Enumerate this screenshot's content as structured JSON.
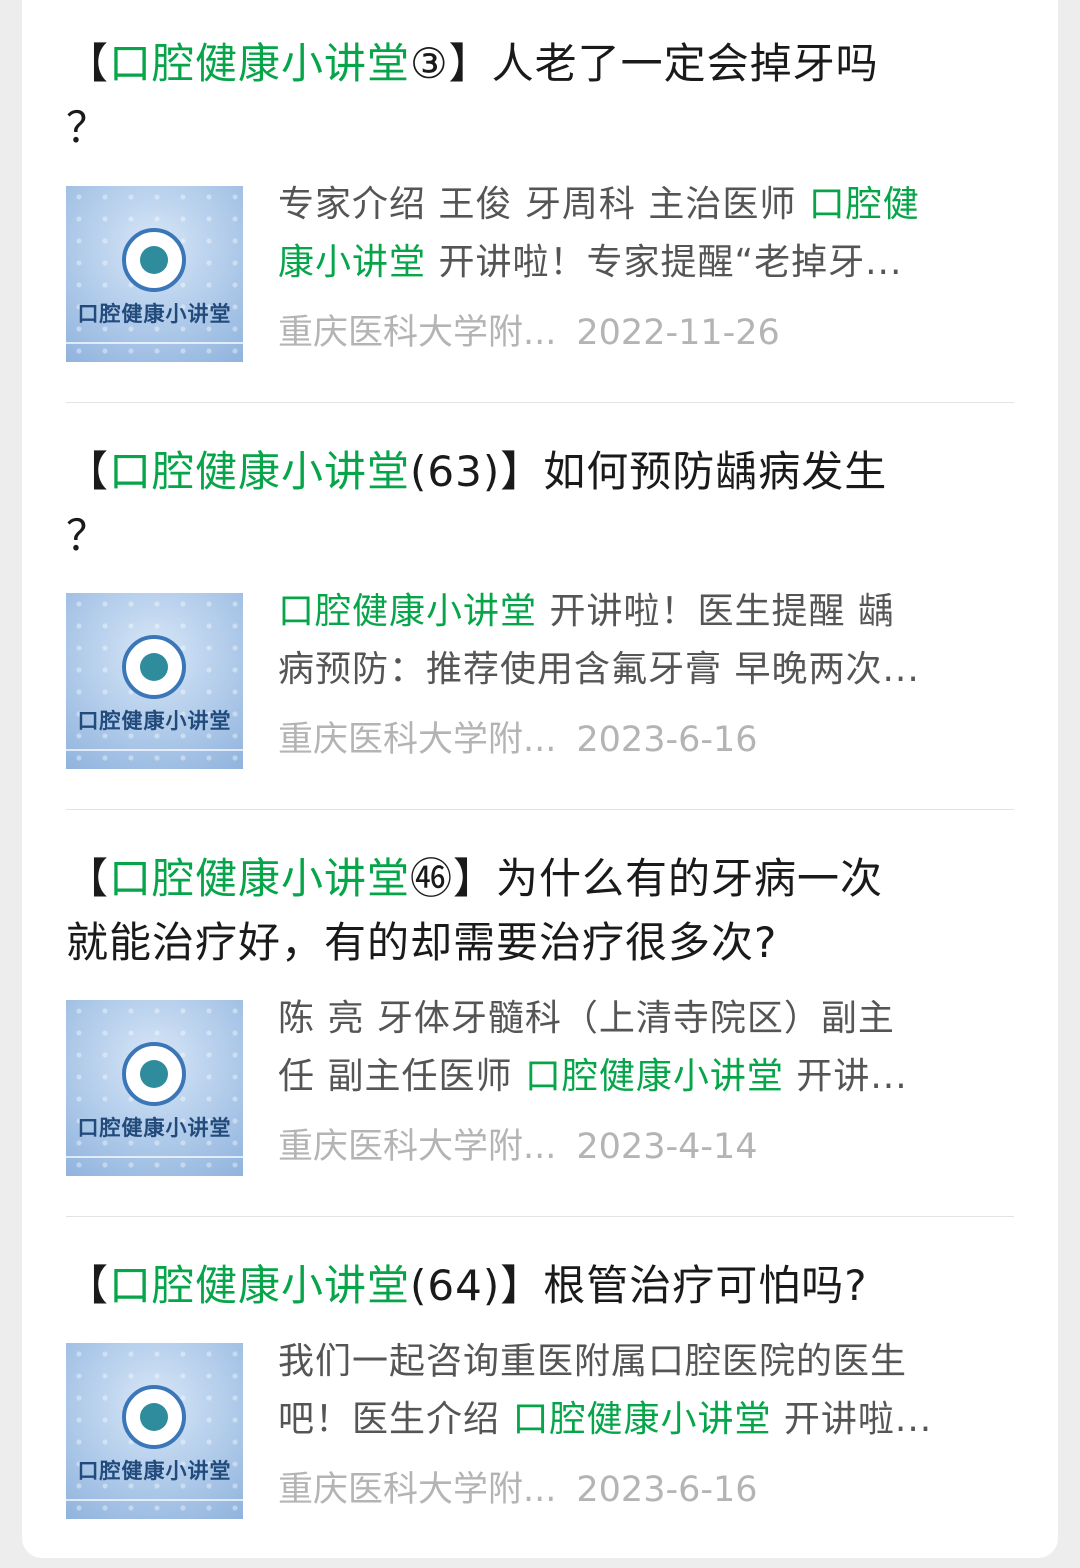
{
  "articles": [
    {
      "title_prefix": "【",
      "title_keyword": "口腔健康小讲堂",
      "title_rest": "③】人老了一定会掉牙吗",
      "title_line2": "？",
      "desc_line1_text": "专家介绍 王俊 牙周科 主治医师 ",
      "desc_line1_kw": "口腔健",
      "desc_line2_kw": "康小讲堂",
      "desc_line2_text": " 开讲啦！专家提醒“老掉牙...",
      "source": "重庆医科大学附...",
      "date": "2022-11-26",
      "thumb_label": "口腔健康小讲堂"
    },
    {
      "title_prefix": "【",
      "title_keyword": "口腔健康小讲堂",
      "title_rest": "(63)】如何预防龋病发生",
      "title_line2": "？",
      "desc_line1_kw": "口腔健康小讲堂",
      "desc_line1_text": " 开讲啦！医生提醒 龋",
      "desc_line2_text": "病预防：推荐使用含氟牙膏 早晚两次...",
      "source": "重庆医科大学附...",
      "date": "2023-6-16",
      "thumb_label": "口腔健康小讲堂"
    },
    {
      "title_prefix": "【",
      "title_keyword": "口腔健康小讲堂",
      "title_rest": "㊻】为什么有的牙病一次",
      "title_line2": "就能治疗好，有的却需要治疗很多次?",
      "desc_line1_text": "陈 亮 牙体牙髓科（上清寺院区）副主",
      "desc_line2_pre": "任 副主任医师 ",
      "desc_line2_kw": "口腔健康小讲堂",
      "desc_line2_text": " 开讲...",
      "source": "重庆医科大学附...",
      "date": "2023-4-14",
      "thumb_label": "口腔健康小讲堂"
    },
    {
      "title_prefix": "【",
      "title_keyword": "口腔健康小讲堂",
      "title_rest": "(64)】根管治疗可怕吗?",
      "desc_line1_text": "我们一起咨询重医附属口腔医院的医生",
      "desc_line2_pre": "吧！医生介绍 ",
      "desc_line2_kw": "口腔健康小讲堂",
      "desc_line2_text": " 开讲啦...",
      "source": "重庆医科大学附...",
      "date": "2023-6-16",
      "thumb_label": "口腔健康小讲堂"
    }
  ],
  "colors": {
    "keyword": "#07a54a",
    "meta": "#b4b4b4",
    "title": "#1a1a1a"
  }
}
